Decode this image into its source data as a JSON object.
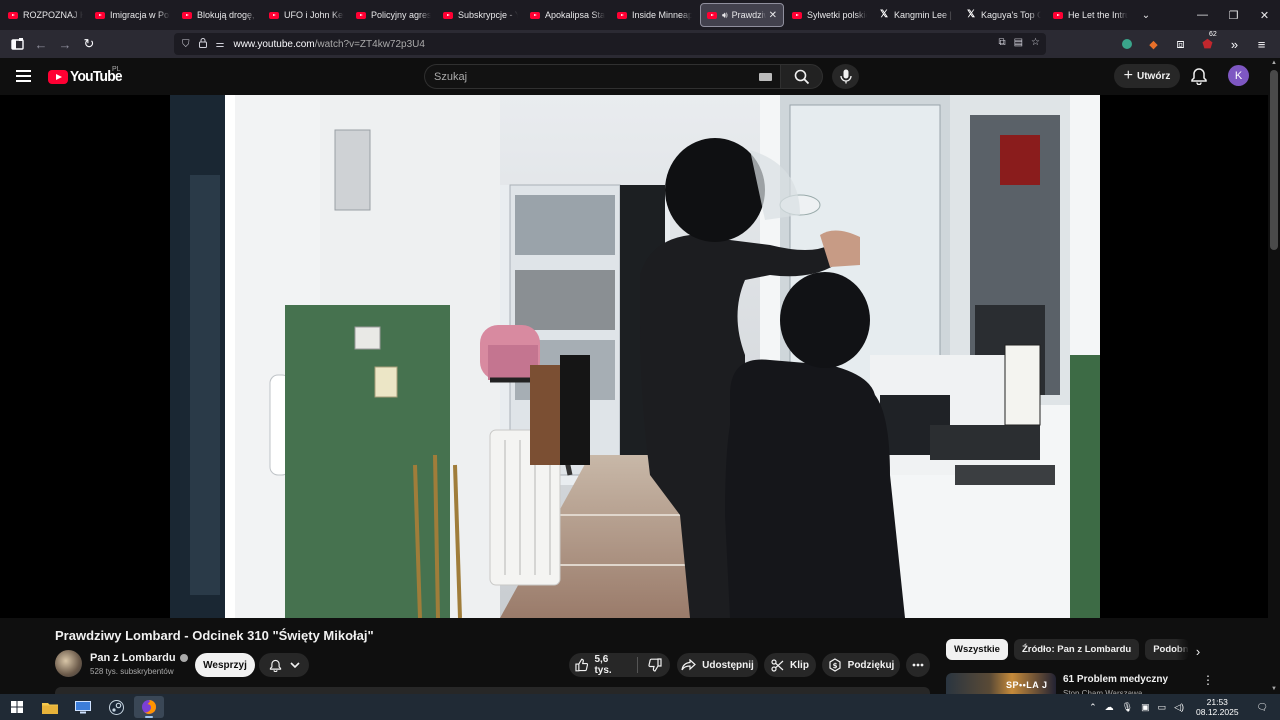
{
  "browser": {
    "tabs": [
      {
        "title": "ROZPOZNAJ KOD",
        "icon": "youtube-icon"
      },
      {
        "title": "Imigracja w Polsce",
        "icon": "youtube-icon"
      },
      {
        "title": "Blokują drogę, za",
        "icon": "youtube-icon"
      },
      {
        "title": "UFO i John Kennedy",
        "icon": "youtube-icon"
      },
      {
        "title": "Policyjny agresor",
        "icon": "youtube-icon"
      },
      {
        "title": "Subskrypcje - YouTube",
        "icon": "youtube-icon"
      },
      {
        "title": "Apokalipsa Stalina",
        "icon": "youtube-icon"
      },
      {
        "title": "Inside Minneapolis",
        "icon": "youtube-icon"
      },
      {
        "title": "Prawdziwy",
        "icon": "youtube-icon",
        "active": true
      },
      {
        "title": "Sylwetki polskich",
        "icon": "youtube-icon"
      },
      {
        "title": "Kangmin Lee | Of",
        "icon": "x-icon"
      },
      {
        "title": "Kaguya's Top Games",
        "icon": "x-icon"
      },
      {
        "title": "He Let the Intruder",
        "icon": "youtube-icon"
      }
    ],
    "url_host": "www.youtube.com",
    "url_path": "/watch?v=ZT4kw72p3U4",
    "extensions_badge": "62"
  },
  "youtube": {
    "logo_text": "YouTube",
    "country_code": "PL",
    "search_placeholder": "Szukaj",
    "create_label": "Utwórz",
    "avatar_letter": "K",
    "avatar_color": "#7e57c2"
  },
  "video": {
    "title": "Prawdziwy Lombard - Odcinek 310 \"Święty Mikołaj\"",
    "channel_name": "Pan z Lombardu",
    "subscribers": "528 tys. subskrybentów",
    "support_label": "Wesprzyj",
    "likes": "5,6 tys.",
    "share_label": "Udostępnij",
    "clip_label": "Klip",
    "thanks_label": "Podziękuj"
  },
  "sidebar": {
    "chips": [
      "Wszystkie",
      "Źródło: Pan z Lombardu",
      "Podobne"
    ],
    "recommendation": {
      "title": "61 Problem medyczny",
      "channel": "Stop Cham Warszawa",
      "thumb_text": "SP••LA J"
    }
  },
  "taskbar": {
    "time": "21:53",
    "date": "08.12.2025"
  }
}
